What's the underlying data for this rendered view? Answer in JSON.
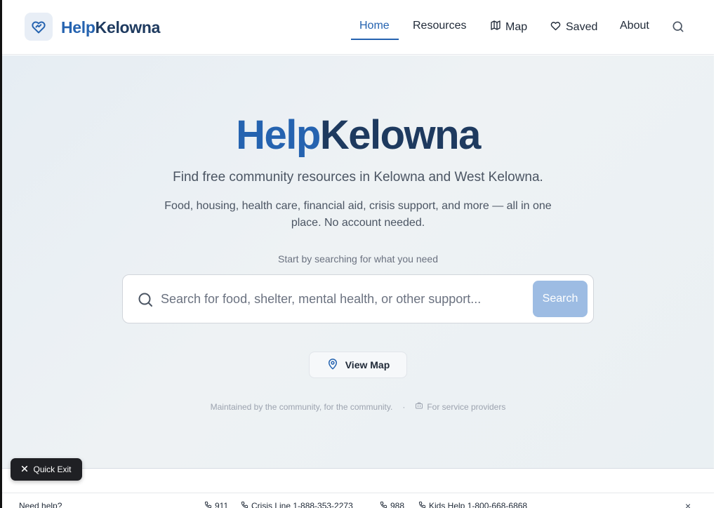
{
  "brand": {
    "help": "Help",
    "kelowna": "Kelowna"
  },
  "nav": {
    "home": "Home",
    "resources": "Resources",
    "map": "Map",
    "saved": "Saved",
    "about": "About"
  },
  "hero": {
    "title_help": "Help",
    "title_kelowna": "Kelowna",
    "subtitle": "Find free community resources in Kelowna and West Kelowna.",
    "description": "Food, housing, health care, financial aid, crisis support, and more — all in one place. No account needed.",
    "prompt": "Start by searching for what you need",
    "search_placeholder": "Search for food, shelter, mental health, or other support...",
    "search_button": "Search",
    "map_button": "View Map",
    "maintained": "Maintained by the community, for the community.",
    "separator": "·",
    "providers": "For service providers"
  },
  "quick_exit": "Quick Exit",
  "help_bar": {
    "need_help": "Need help?",
    "numbers": [
      "911",
      "Crisis Line 1-888-353-2273",
      "988",
      "Kids Help 1-800-668-6868"
    ],
    "close": "×"
  },
  "colors": {
    "accent": "#2563b0",
    "navy": "#1e3a5f",
    "search_button": "#9dbce3"
  }
}
